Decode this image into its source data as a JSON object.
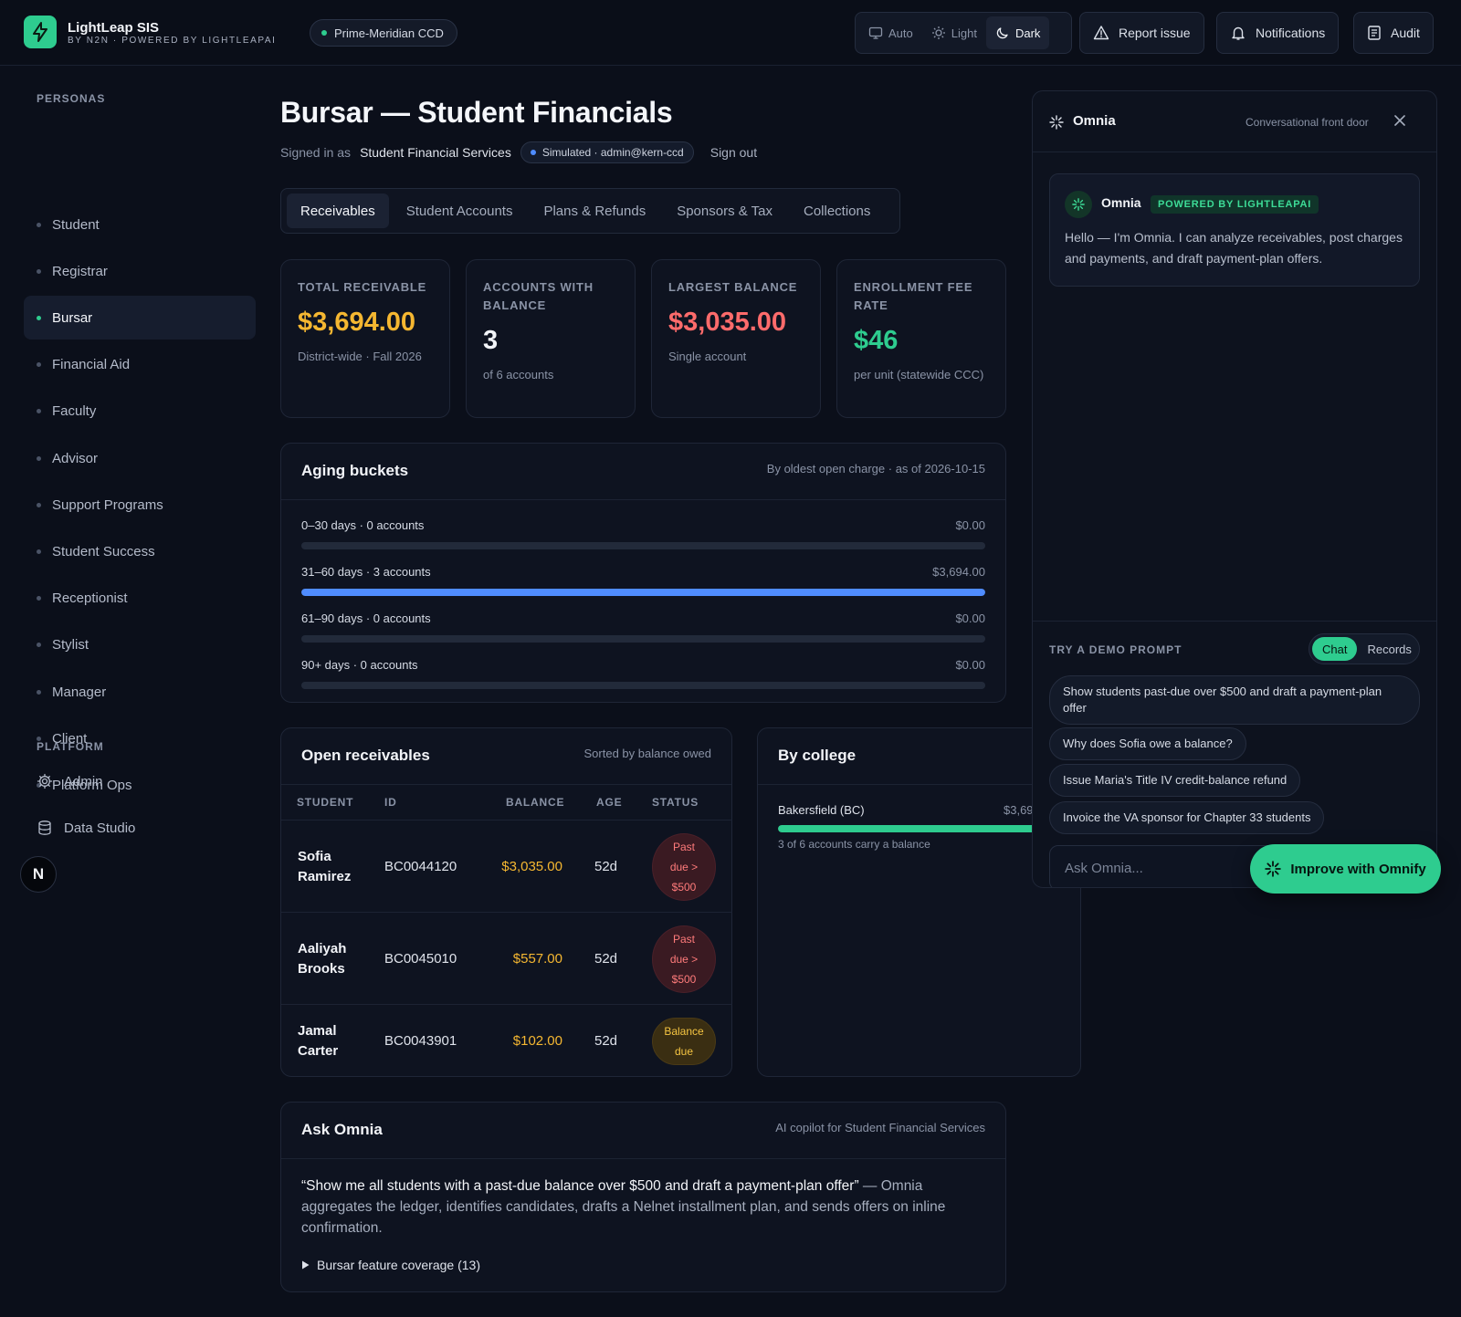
{
  "brand": {
    "name": "LightLeap SIS",
    "subtitle": "BY N2N · POWERED BY LIGHTLEAPAI",
    "tenant": "Prime-Meridian CCD"
  },
  "theme": {
    "options": [
      "Auto",
      "Light",
      "Dark"
    ],
    "active": "Dark"
  },
  "top_actions": {
    "report": "Report issue",
    "notifications": "Notifications",
    "audit": "Audit"
  },
  "sidebar": {
    "personas_heading": "PERSONAS",
    "personas": [
      "Student",
      "Registrar",
      "Bursar",
      "Financial Aid",
      "Faculty",
      "Advisor",
      "Support Programs",
      "Student Success",
      "Receptionist",
      "Stylist",
      "Manager",
      "Client",
      "Platform Ops"
    ],
    "active": "Bursar",
    "platform_heading": "PLATFORM",
    "platform": [
      "Admin",
      "Data Studio"
    ],
    "avatar_letter": "N"
  },
  "page": {
    "title": "Bursar — Student Financials",
    "signed_in_prefix": "Signed in as",
    "signed_in_user": "Student Financial Services",
    "simulated": "Simulated · admin@kern-ccd",
    "sign_out": "Sign out"
  },
  "tabs": [
    "Receivables",
    "Student Accounts",
    "Plans & Refunds",
    "Sponsors & Tax",
    "Collections"
  ],
  "kpis": [
    {
      "label": "TOTAL RECEIVABLE",
      "value": "$3,694.00",
      "note": "District-wide · Fall 2026"
    },
    {
      "label": "ACCOUNTS WITH BALANCE",
      "value": "3",
      "note": "of 6 accounts"
    },
    {
      "label": "LARGEST BALANCE",
      "value": "$3,035.00",
      "note": "Single account"
    },
    {
      "label": "ENROLLMENT FEE RATE",
      "value": "$46",
      "note": "per unit (statewide CCC)"
    }
  ],
  "colors": {
    "accent": "#2ecc8f",
    "amber": "#f5b731",
    "red": "#ff6b6b",
    "blue": "#4f8cff"
  },
  "aging": {
    "title": "Aging buckets",
    "subtitle": "By oldest open charge · as of 2026-10-15",
    "buckets": [
      {
        "label": "0–30 days · 0 accounts",
        "amount": "$0.00",
        "fill": 0
      },
      {
        "label": "31–60 days · 3 accounts",
        "amount": "$3,694.00",
        "fill": 1
      },
      {
        "label": "61–90 days · 0 accounts",
        "amount": "$0.00",
        "fill": 0
      },
      {
        "label": "90+ days · 0 accounts",
        "amount": "$0.00",
        "fill": 0
      }
    ]
  },
  "receivables": {
    "title": "Open receivables",
    "subtitle": "Sorted by balance owed",
    "columns": [
      "STUDENT",
      "ID",
      "BALANCE",
      "AGE",
      "STATUS"
    ],
    "rows": [
      {
        "student_first": "Sofia",
        "student_last": "Ramirez",
        "id": "BC0044120",
        "balance": "$3,035.00",
        "age": "52d",
        "status_lines": [
          "Past",
          "due >",
          "$500"
        ],
        "status_type": "red"
      },
      {
        "student_first": "Aaliyah",
        "student_last": "Brooks",
        "id": "BC0045010",
        "balance": "$557.00",
        "age": "52d",
        "status_lines": [
          "Past",
          "due >",
          "$500"
        ],
        "status_type": "red"
      },
      {
        "student_first": "Jamal",
        "student_last": "Carter",
        "id": "BC0043901",
        "balance": "$102.00",
        "age": "52d",
        "status_lines": [
          "Balance",
          "due"
        ],
        "status_type": "amber"
      }
    ]
  },
  "by_college": {
    "title": "By college",
    "college": "Bakersfield (BC)",
    "amount": "$3,69",
    "fill": 1,
    "note": "3 of 6 accounts carry a balance"
  },
  "ask_omnia": {
    "title": "Ask Omnia",
    "subtitle": "AI copilot for Student Financial Services",
    "quote": "“Show me all students with a past-due balance over $500 and draft a payment-plan offer”",
    "description": " — Omnia aggregates the ledger, identifies candidates, drafts a Nelnet installment plan, and sends offers on inline confirmation.",
    "coverage": "Bursar feature coverage (13)"
  },
  "omnia": {
    "title": "Omnia",
    "subtitle": "Conversational front door",
    "bot_name": "Omnia",
    "badge": "POWERED BY LIGHTLEAPAI",
    "greeting": "Hello — I'm Omnia. I can analyze receivables, post charges and payments, and draft payment-plan offers.",
    "demo_heading": "TRY A DEMO PROMPT",
    "modes": [
      "Chat",
      "Records"
    ],
    "active_mode": "Chat",
    "prompts": [
      "Show students past-due over $500 and draft a payment-plan offer",
      "Why does Sofia owe a balance?",
      "Issue Maria's Title IV credit-balance refund",
      "Invoice the VA sponsor for Chapter 33 students"
    ],
    "input_placeholder": "Ask Omnia...",
    "improve_button": "Improve with Omnify"
  }
}
